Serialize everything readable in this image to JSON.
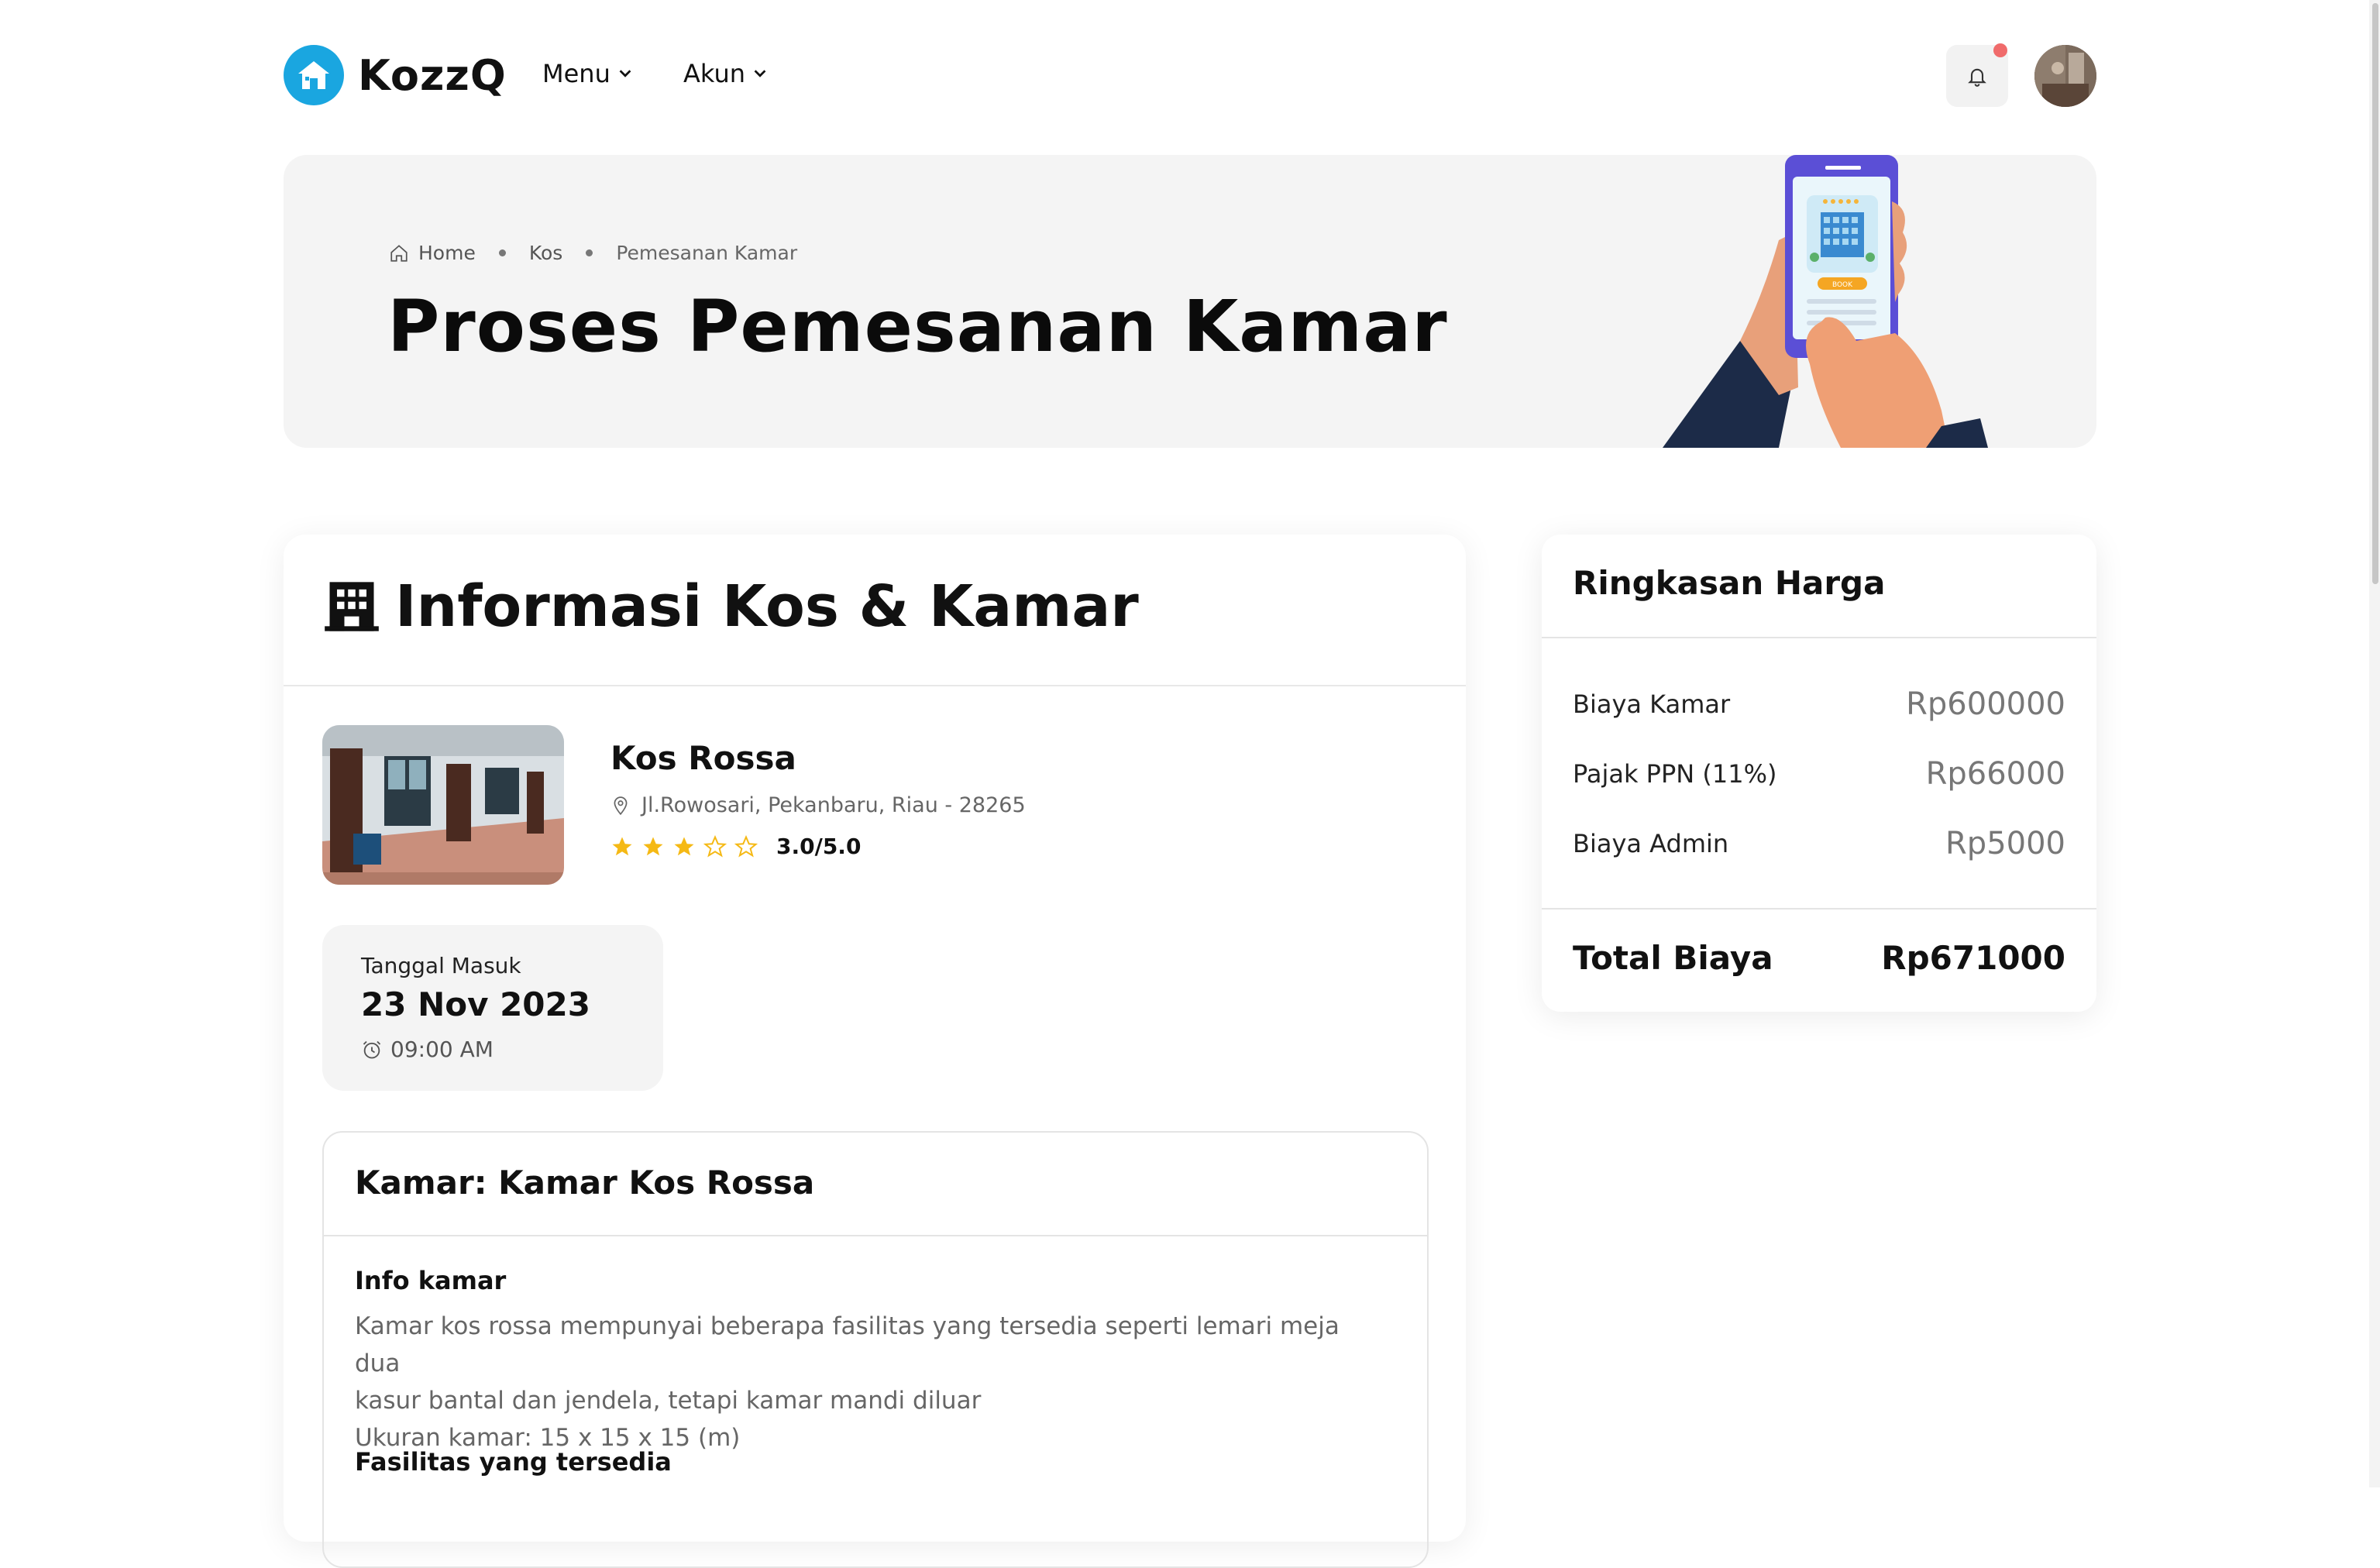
{
  "header": {
    "logo_text": "KozzQ",
    "nav": [
      {
        "label": "Menu"
      },
      {
        "label": "Akun"
      }
    ],
    "notification_icon": "bell-icon",
    "colors": {
      "brand": "#1aa6e0",
      "notification_dot": "#f06b6b"
    }
  },
  "hero": {
    "breadcrumb": [
      "Home",
      "Kos",
      "Pemesanan Kamar"
    ],
    "title": "Proses Pemesanan Kamar",
    "illustration_button": "BOOK"
  },
  "info": {
    "title": "Informasi Kos & Kamar",
    "kos": {
      "name": "Kos Rossa",
      "address": "Jl.Rowosari, Pekanbaru, Riau - 28265",
      "rating": 3.0,
      "rating_max": 5,
      "rating_text": "3.0/5.0"
    },
    "date": {
      "label": "Tanggal Masuk",
      "value": "23 Nov 2023",
      "time": "09:00 AM"
    },
    "room": {
      "title": "Kamar: Kamar Kos Rossa",
      "info_label": "Info kamar",
      "info_lines": [
        "Kamar kos rossa mempunyai beberapa fasilitas yang tersedia seperti lemari meja dua",
        "kasur bantal dan jendela, tetapi kamar mandi diluar",
        "Ukuran kamar: 15 x 15 x 15 (m)"
      ],
      "facilities_label": "Fasilitas yang tersedia"
    }
  },
  "summary": {
    "title": "Ringkasan Harga",
    "rows": [
      {
        "label": "Biaya Kamar",
        "value": "Rp600000"
      },
      {
        "label": "Pajak PPN (11%)",
        "value": "Rp66000"
      },
      {
        "label": "Biaya Admin",
        "value": "Rp5000"
      }
    ],
    "total_label": "Total Biaya",
    "total_value": "Rp671000"
  }
}
